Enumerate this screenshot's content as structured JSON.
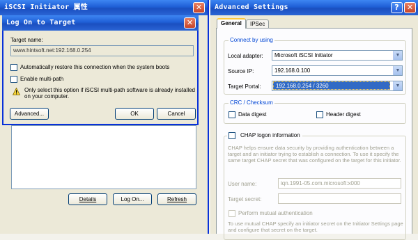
{
  "back_window": {
    "title": "iSCSI Initiator 属性",
    "buttons": {
      "details": "Details",
      "logon": "Log On...",
      "refresh": "Refresh"
    }
  },
  "logon_dialog": {
    "title": "Log On to Target",
    "target_label": "Target name:",
    "target_value": "www.hintsoft.net:192.168.0.254",
    "auto_restore_label": "Automatically restore this connection when the system boots",
    "multipath_label": "Enable multi-path",
    "info_text": "Only select this option if iSCSI multi-path software is already installed on your computer.",
    "buttons": {
      "advanced": "Advanced...",
      "ok": "OK",
      "cancel": "Cancel"
    }
  },
  "advanced_window": {
    "title": "Advanced Settings",
    "tabs": [
      {
        "label": "General",
        "active": true
      },
      {
        "label": "IPSec",
        "active": false
      }
    ],
    "connect_group": {
      "title": "Connect by using",
      "local_adapter_label": "Local adapter:",
      "local_adapter_value": "Microsoft iSCSI Initiator",
      "source_ip_label": "Source IP:",
      "source_ip_value": "192.168.0.100",
      "target_portal_label": "Target Portal:",
      "target_portal_value": "192.168.0.254 / 3260"
    },
    "crc_group": {
      "title": "CRC / Checksum",
      "data_digest_label": "Data digest",
      "header_digest_label": "Header digest"
    },
    "chap": {
      "checkbox_label": "CHAP logon information",
      "description": "CHAP helps ensure data security by providing authentication between a target and an initiator trying to establish a connection. To use it specify the same target CHAP secret that was configured on the target for this initiator.",
      "user_name_label": "User name:",
      "user_name_value": "iqn.1991-05.com.microsoft:x000",
      "target_secret_label": "Target secret:",
      "mutual_label": "Perform mutual authentication",
      "mutual_description": "To use mutual CHAP specify an initiator secret on the Initiator Settings page and configure that secret on the target."
    }
  },
  "colors": {
    "title_bar": "#1f5fd6",
    "group_title": "#0046d5",
    "selected": "#316ac5"
  }
}
